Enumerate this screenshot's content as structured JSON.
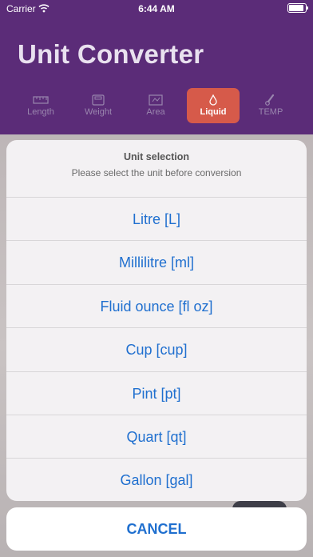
{
  "status_bar": {
    "carrier": "Carrier",
    "time": "6:44 AM",
    "battery_level": 0.9
  },
  "app": {
    "title": "Unit Converter"
  },
  "tabs": [
    {
      "label": "Length",
      "icon": "ruler-icon",
      "active": false
    },
    {
      "label": "Weight",
      "icon": "scale-icon",
      "active": false
    },
    {
      "label": "Area",
      "icon": "area-icon",
      "active": false
    },
    {
      "label": "Liquid",
      "icon": "droplet-icon",
      "active": true
    },
    {
      "label": "TEMP",
      "icon": "thermometer-icon",
      "active": false
    }
  ],
  "action_sheet": {
    "title": "Unit selection",
    "message": "Please select the unit before conversion",
    "options": [
      "Litre [L]",
      "Millilitre [ml]",
      "Fluid ounce [fl oz]",
      "Cup [cup]",
      "Pint [pt]",
      "Quart [qt]",
      "Gallon [gal]"
    ],
    "cancel_label": "CANCEL"
  },
  "colors": {
    "header_bg": "#5b2c78",
    "active_tab": "#d65a4a",
    "action_blue": "#1f6fcf"
  }
}
